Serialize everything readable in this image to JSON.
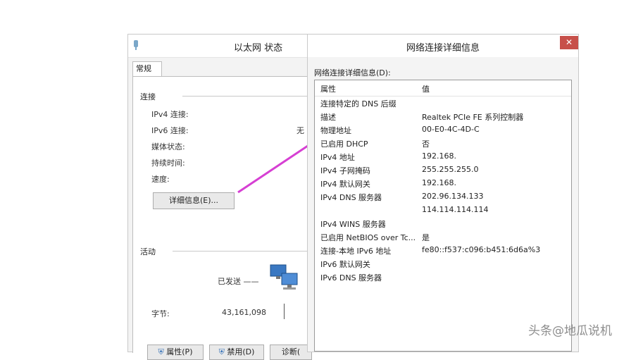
{
  "status_window": {
    "title": "以太网 状态",
    "tab": "常规",
    "connection": {
      "label": "连接",
      "fields": [
        {
          "label": "IPv4 连接:",
          "value": ""
        },
        {
          "label": "IPv6 连接:",
          "value": "无"
        },
        {
          "label": "媒体状态:",
          "value": ""
        },
        {
          "label": "持续时间:",
          "value": ""
        },
        {
          "label": "速度:",
          "value": ""
        }
      ],
      "details_button": "详细信息(E)..."
    },
    "activity": {
      "label": "活动",
      "sent_label": "已发送 ——",
      "bytes_label": "字节:",
      "bytes_sent": "43,161,098"
    },
    "buttons": {
      "properties": "属性(P)",
      "disable": "禁用(D)",
      "diagnose": "诊断("
    }
  },
  "details_window": {
    "title": "网络连接详细信息",
    "close_glyph": "✕",
    "list_label": "网络连接详细信息(D):",
    "columns": {
      "property": "属性",
      "value": "值"
    },
    "rows": [
      {
        "property": "连接特定的 DNS 后缀",
        "value": ""
      },
      {
        "property": "描述",
        "value": "Realtek PCIe FE 系列控制器"
      },
      {
        "property": "物理地址",
        "value": "00-E0-4C-4D-C"
      },
      {
        "property": "已启用 DHCP",
        "value": "否"
      },
      {
        "property": "IPv4 地址",
        "value": "192.168."
      },
      {
        "property": "IPv4 子网掩码",
        "value": "255.255.255.0"
      },
      {
        "property": "IPv4 默认网关",
        "value": "192.168."
      },
      {
        "property": "IPv4 DNS 服务器",
        "value": "202.96.134.133"
      },
      {
        "property": "",
        "value": "114.114.114.114"
      },
      {
        "property": "IPv4 WINS 服务器",
        "value": ""
      },
      {
        "property": "已启用 NetBIOS over Tc...",
        "value": "是"
      },
      {
        "property": "连接-本地 IPv6 地址",
        "value": "fe80::f537:c096:b451:6d6a%3"
      },
      {
        "property": "IPv6 默认网关",
        "value": ""
      },
      {
        "property": "IPv6 DNS 服务器",
        "value": ""
      }
    ]
  },
  "watermark": "头条@地瓜说机",
  "colors": {
    "arrow": "#d63fd3",
    "close": "#c7504a"
  }
}
